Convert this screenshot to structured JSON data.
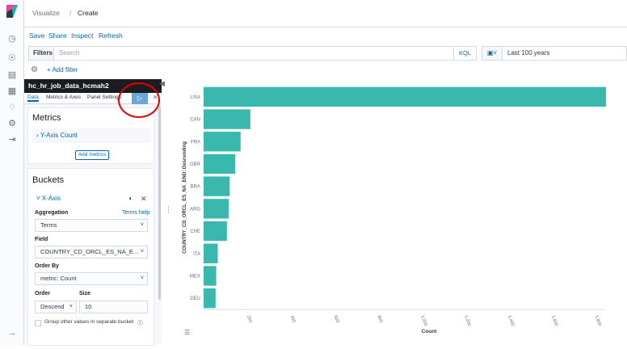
{
  "breadcrumb": {
    "parent": "Visualize",
    "separator": "/",
    "current": "Create"
  },
  "toolbar": {
    "save": "Save",
    "share": "Share",
    "inspect": "Inspect",
    "refresh": "Refresh"
  },
  "query": {
    "filters_label": "Filters",
    "search_placeholder": "Search",
    "kql": "KQL",
    "date_range": "Last 100 years",
    "add_filter": "+ Add filter"
  },
  "sidebar": {
    "index_title": "hc_hr_job_data_hcmah2",
    "tabs": [
      "Data",
      "Metrics & Axes",
      "Panel Settings"
    ],
    "metrics": {
      "title": "Metrics",
      "y_axis": "Y-Axis Count",
      "add_button": "Add metrics"
    },
    "buckets": {
      "title": "Buckets",
      "x_axis": "X-Axis",
      "aggregation_label": "Aggregation",
      "terms_help": "Terms help",
      "aggregation_value": "Terms",
      "field_label": "Field",
      "field_value": "COUNTRY_CD_ORCL_ES_NA_E...",
      "order_by_label": "Order By",
      "order_by_value": "metric: Count",
      "order_label": "Order",
      "order_value": "Descend",
      "size_label": "Size",
      "size_value": "10",
      "group_other": "Group other values in separate bucket"
    }
  },
  "colors": {
    "bar": "#3bb8ad",
    "accent": "#006bb4",
    "annotation": "#e00000"
  },
  "chart_data": {
    "type": "bar",
    "orientation": "horizontal",
    "categories": [
      "USA",
      "CAN",
      "FRA",
      "GBR",
      "BRA",
      "ARG",
      "CHE",
      "ITA",
      "MEX",
      "DEU"
    ],
    "values": [
      1850,
      215,
      170,
      145,
      120,
      115,
      107,
      65,
      58,
      55
    ],
    "xlabel": "Count",
    "ylabel": "COUNTRY_CD_ORCL_ES_NA_END: Descending",
    "xticks": [
      "200",
      "400",
      "600",
      "800",
      "1,000",
      "1,200",
      "1,400",
      "1,600",
      "1,800"
    ],
    "xlim": [
      0,
      1850
    ],
    "grid": false
  }
}
